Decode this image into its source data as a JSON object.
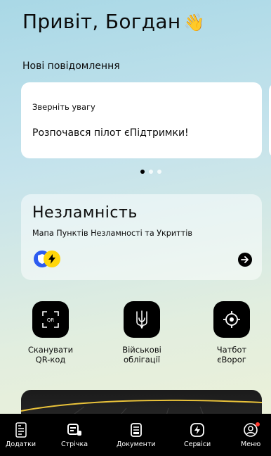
{
  "greeting": {
    "text": "Привіт, Богдан",
    "emoji": "👋"
  },
  "notifications": {
    "title": "Нові повідомлення",
    "cards": [
      {
        "small": "Зверніть увагу",
        "main": "Розпочався пілот єПідтримки!"
      }
    ],
    "pager": {
      "total": 3,
      "active": 1
    }
  },
  "invincibility": {
    "title": "Незламність",
    "subtitle": "Мапа Пунктів Незламності та Укриттів"
  },
  "quick_actions": [
    {
      "label": "Сканувати\nQR-код",
      "icon": "qr-scan-icon",
      "qr_text": "QR"
    },
    {
      "label": "Військові\nоблігації",
      "icon": "trident-icon"
    },
    {
      "label": "Чатбот\nєВорог",
      "icon": "target-icon"
    }
  ],
  "tabbar": {
    "items": [
      {
        "label": "Додатки",
        "icon": "apps-icon"
      },
      {
        "label": "Стрічка",
        "icon": "feed-icon"
      },
      {
        "label": "Документи",
        "icon": "documents-icon"
      },
      {
        "label": "Сервіси",
        "icon": "services-icon"
      },
      {
        "label": "Меню",
        "icon": "menu-profile-icon"
      }
    ]
  },
  "colors": {
    "background_top": "#a9d8e6",
    "background_bottom": "#eef1d6",
    "shield_blue": "#2d5cf0",
    "bolt_yellow": "#ffd60a",
    "notification_red": "#ff3b30"
  }
}
